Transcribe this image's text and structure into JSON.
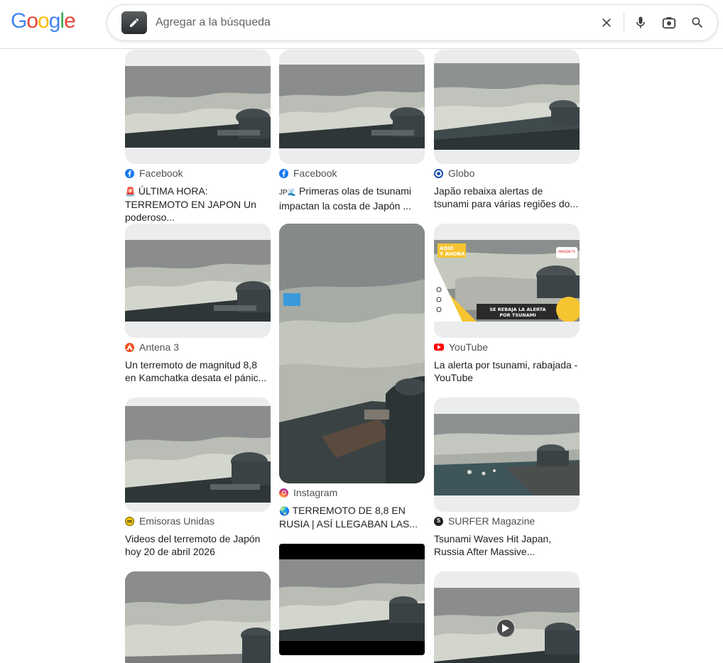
{
  "logo": {
    "text": "Google"
  },
  "search": {
    "placeholder": "Agregar a la búsqueda",
    "value": ""
  },
  "icons": {
    "thumb": "pencil-edit-icon",
    "clear": "close-icon",
    "voice": "microphone-icon",
    "lens": "camera-lens-icon",
    "search": "search-icon"
  },
  "results": [
    {
      "source": "Facebook",
      "source_icon": "facebook-icon",
      "prefix": "🚨",
      "title": "ÚLTIMA HORA: TERREMOTO EN JAPON Un poderoso..."
    },
    {
      "source": "Facebook",
      "source_icon": "facebook-icon",
      "prefix": "JP🌊",
      "title": "Primeras olas de tsunami impactan la costa de Japón ..."
    },
    {
      "source": "Globo",
      "source_icon": "globo-icon",
      "prefix": "",
      "title": "Japão rebaixa alertas de tsunami para várias regiões do..."
    },
    {
      "source": "Antena 3",
      "source_icon": "antena3-icon",
      "prefix": "",
      "title": "Un terremoto de magnitud 8,8 en Kamchatka desata el pánic..."
    },
    {
      "source": "Instagram",
      "source_icon": "instagram-icon",
      "prefix": "🌏",
      "title": "TERREMOTO DE 8,8 EN RUSIA | ASÍ LLEGABAN LAS..."
    },
    {
      "source": "YouTube",
      "source_icon": "youtube-icon",
      "prefix": "",
      "title": "La alerta por tsunami, rabajada - YouTube"
    },
    {
      "source": "Emisoras Unidas",
      "source_icon": "emisoras-unidas-icon",
      "prefix": "",
      "title": "Videos del terremoto de Japón hoy 20 de abril 2026"
    },
    {
      "source": "SURFER Magazine",
      "source_icon": "surfer-icon",
      "prefix": "",
      "title": "Tsunami Waves Hit Japan, Russia After Massive..."
    }
  ],
  "overlay": {
    "aqui_line1": "AQUÍ",
    "aqui_line2": "Y AHORA",
    "tag": "ARAGÓN TV",
    "banner_line1": "SE REBAJA LA ALERTA",
    "banner_line2": "POR TSUNAMI"
  },
  "colors": {
    "accent_blue": "#1a73e8",
    "facebook": "#1877f2",
    "youtube": "#ff0000",
    "antena3": "#f4511e",
    "emisoras": "#f5c400",
    "surfer": "#202124"
  }
}
